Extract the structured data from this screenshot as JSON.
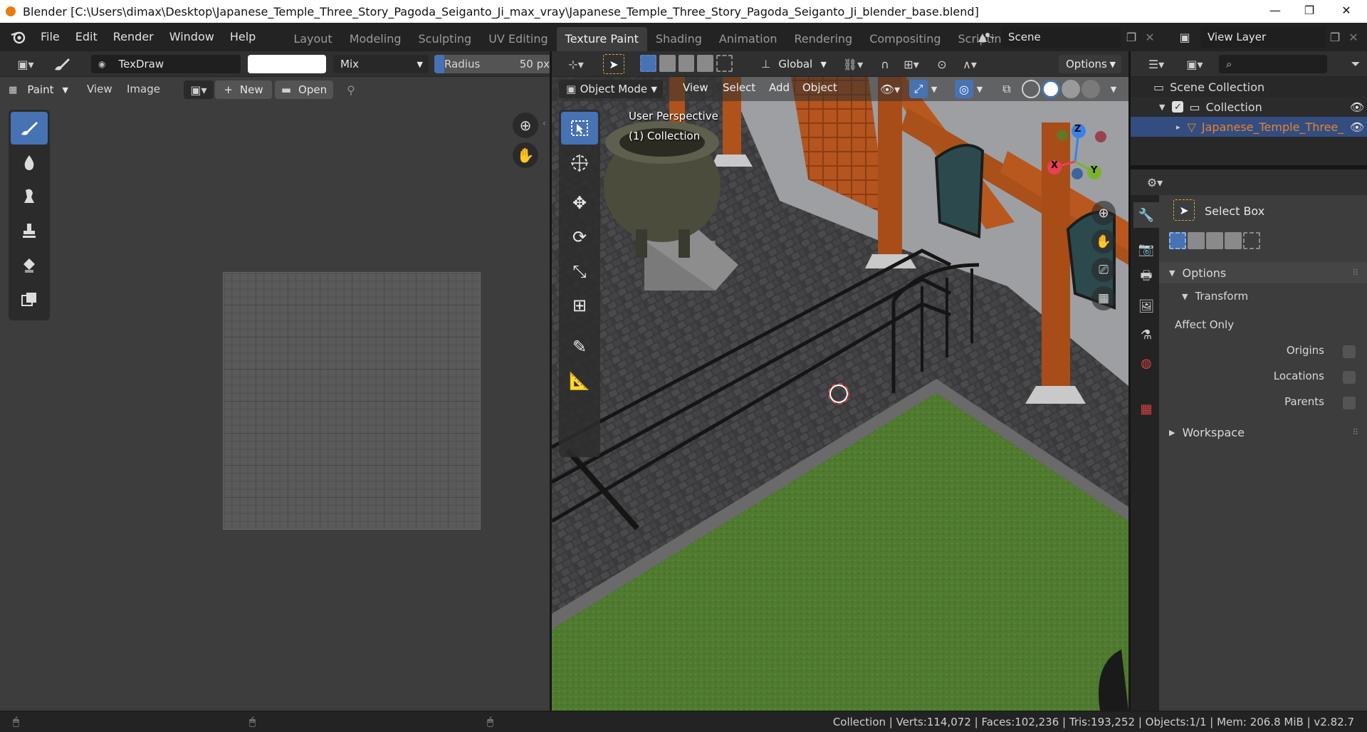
{
  "window": {
    "title": "Blender [C:\\Users\\dimax\\Desktop\\Japanese_Temple_Three_Story_Pagoda_Seiganto_Ji_max_vray\\Japanese_Temple_Three_Story_Pagoda_Seiganto_Ji_blender_base.blend]",
    "controls": [
      "—",
      "❐",
      "✕"
    ]
  },
  "menu": {
    "items": [
      "File",
      "Edit",
      "Render",
      "Window",
      "Help"
    ]
  },
  "workspaces": {
    "tabs": [
      "Layout",
      "Modeling",
      "Sculpting",
      "UV Editing",
      "Texture Paint",
      "Shading",
      "Animation",
      "Rendering",
      "Compositing",
      "Scripting"
    ],
    "active": "Texture Paint",
    "add": "+"
  },
  "scene": {
    "label": "Scene"
  },
  "view_layer": {
    "label": "View Layer"
  },
  "image_editor": {
    "brush_name": "TexDraw",
    "blend_mode": "Mix",
    "radius_label": "Radius",
    "radius_value": "50 px",
    "mode": "Paint",
    "menus": [
      "View",
      "Image"
    ],
    "new_label": "New",
    "open_label": "Open"
  },
  "viewport": {
    "mode": "Object Mode",
    "menus": [
      "View",
      "Select",
      "Add",
      "Object"
    ],
    "orientation": "Global",
    "options": "Options",
    "overlay_line1": "User Perspective",
    "overlay_line2": "(1) Collection",
    "gizmo": {
      "x": "X",
      "y": "Y",
      "z": "Z"
    }
  },
  "outliner": {
    "scene_collection": "Scene Collection",
    "collection": "Collection",
    "object": "Japanese_Temple_Three_"
  },
  "properties": {
    "tool_name": "Select Box",
    "options_label": "Options",
    "transform_label": "Transform",
    "affect_only": "Affect Only",
    "origins": "Origins",
    "locations": "Locations",
    "parents": "Parents",
    "workspace_label": "Workspace"
  },
  "status_bar": {
    "stats": "Collection | Verts:114,072 | Faces:102,236 | Tris:193,252 | Objects:1/1 | Mem: 206.8 MiB | v2.82.7"
  },
  "colors": {
    "accent": "#4772b3",
    "active_object": "#e8822f",
    "header_bg": "#303030",
    "panel_bg": "#3d3d3d"
  }
}
